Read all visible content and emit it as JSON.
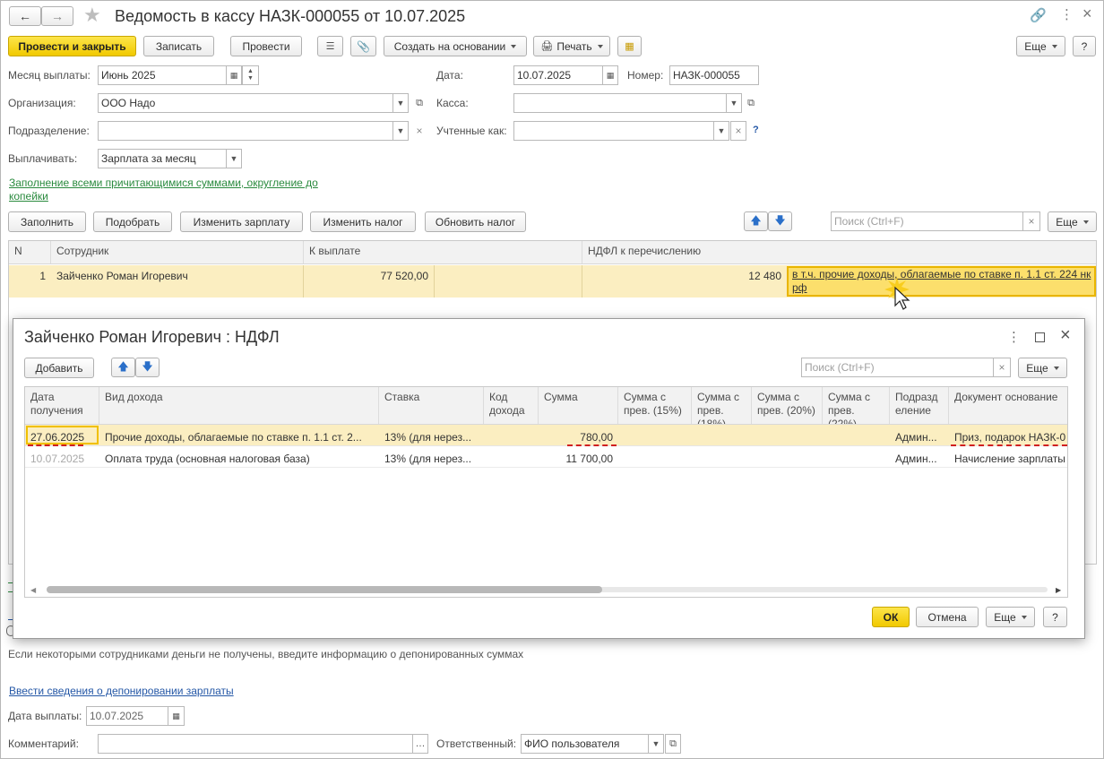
{
  "window": {
    "title": "Ведомость в кассу НАЗК-000055 от 10.07.2025"
  },
  "toolbar": {
    "post_close": "Провести и закрыть",
    "write": "Записать",
    "post": "Провести",
    "create_based": "Создать на основании",
    "print": "Печать",
    "more": "Еще",
    "help": "?"
  },
  "form": {
    "month_label": "Месяц выплаты:",
    "month_value": "Июнь 2025",
    "date_label": "Дата:",
    "date_value": "10.07.2025",
    "number_label": "Номер:",
    "number_value": "НАЗК-000055",
    "org_label": "Организация:",
    "org_value": "ООО Надо",
    "cash_label": "Касса:",
    "cash_value": "",
    "dept_label": "Подразделение:",
    "dept_value": "",
    "accounted_label": "Учтенные как:",
    "accounted_value": "",
    "help_q": "?",
    "pay_label": "Выплачивать:",
    "pay_value": "Зарплата за месяц",
    "fill_link": "Заполнение всеми причитающимися суммами, округление до копейки"
  },
  "table_toolbar": {
    "fill": "Заполнить",
    "select": "Подобрать",
    "change_salary": "Изменить зарплату",
    "change_tax": "Изменить налог",
    "refresh_tax": "Обновить налог",
    "search_placeholder": "Поиск (Ctrl+F)",
    "more": "Еще"
  },
  "main_table": {
    "headers": [
      "N",
      "Сотрудник",
      "К выплате",
      "НДФЛ к перечислению"
    ],
    "rows": [
      {
        "n": "1",
        "employee": "Зайченко Роман Игоревич",
        "to_pay": "77 520,00",
        "ndfl": "12 480",
        "ndfl_note": "в т.ч. прочие доходы, облагаемые по ставке п. 1.1 ст. 224 нк рф"
      }
    ]
  },
  "dialog": {
    "title": "Зайченко Роман Игоревич : НДФЛ",
    "add": "Добавить",
    "search_placeholder": "Поиск (Ctrl+F)",
    "more": "Еще",
    "headers": [
      "Дата получения",
      "Вид дохода",
      "Ставка",
      "Код дохода",
      "Сумма",
      "Сумма с прев. (15%)",
      "Сумма с прев. (18%)",
      "Сумма с прев. (20%)",
      "Сумма с прев. (22%)",
      "Подразделение",
      "Документ основание"
    ],
    "rows": [
      {
        "date": "27.06.2025",
        "income": "Прочие доходы, облагаемые по ставке п. 1.1 ст. 2...",
        "rate": "13% (для нерез...",
        "code": "",
        "sum": "780,00",
        "dept": "Админ...",
        "doc": "Приз, подарок НАЗК-0"
      },
      {
        "date": "10.07.2025",
        "income": "Оплата труда (основная налоговая база)",
        "rate": "13% (для нерез...",
        "code": "",
        "sum": "11 700,00",
        "dept": "Админ...",
        "doc": "Начисление зарплаты"
      }
    ],
    "ok": "ОК",
    "cancel": "Отмена",
    "more2": "Еще",
    "help": "?"
  },
  "bottom": {
    "deposit_hint": "Если некоторыми сотрудниками деньги не получены, введите информацию о депонированных суммах",
    "deposit_link": "Ввести сведения о депонировании зарплаты",
    "pay_date_label": "Дата выплаты:",
    "pay_date_value": "10.07.2025",
    "comment_label": "Комментарий:",
    "comment_value": "",
    "responsible_label": "Ответственный:",
    "responsible_value": "ФИО пользователя"
  }
}
